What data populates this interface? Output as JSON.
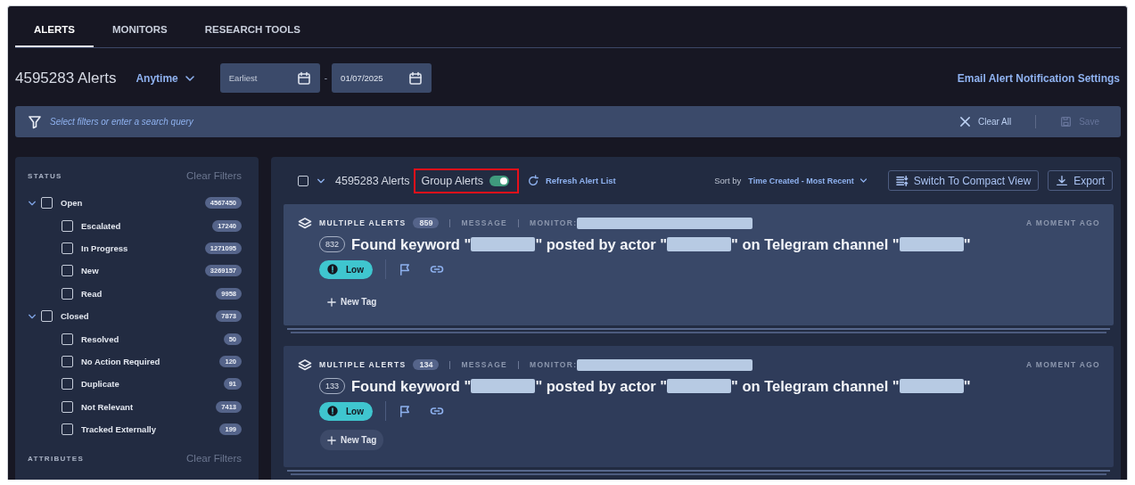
{
  "tabs": [
    {
      "label": "ALERTS",
      "selected": true
    },
    {
      "label": "MONITORS",
      "selected": false
    },
    {
      "label": "RESEARCH TOOLS",
      "selected": false
    }
  ],
  "header": {
    "count": "4595283 Alerts",
    "range": "Anytime",
    "date_from": {
      "placeholder": "Earliest"
    },
    "date_to": {
      "value": "01/07/2025"
    },
    "date_separator": "-",
    "settings_link": "Email Alert Notification Settings"
  },
  "filter_bar": {
    "placeholder": "Select filters or enter a search query",
    "clear": "Clear All",
    "save": {
      "label": "Save",
      "disabled": true
    }
  },
  "sidebar": {
    "sections": [
      {
        "title": "STATUS",
        "clear": "Clear Filters",
        "items": [
          {
            "label": "Open",
            "count": "4567450",
            "checked": false,
            "expanded": true,
            "children": [
              {
                "label": "Escalated",
                "count": "17240",
                "checked": false
              },
              {
                "label": "In Progress",
                "count": "1271095",
                "checked": false
              },
              {
                "label": "New",
                "count": "3269157",
                "checked": false
              },
              {
                "label": "Read",
                "count": "9958",
                "checked": false
              }
            ]
          },
          {
            "label": "Closed",
            "count": "7873",
            "checked": false,
            "expanded": true,
            "children": [
              {
                "label": "Resolved",
                "count": "50",
                "checked": false
              },
              {
                "label": "No Action Required",
                "count": "120",
                "checked": false
              },
              {
                "label": "Duplicate",
                "count": "91",
                "checked": false
              },
              {
                "label": "Not Relevant",
                "count": "7413",
                "checked": false
              },
              {
                "label": "Tracked Externally",
                "count": "199",
                "checked": false
              }
            ]
          }
        ]
      },
      {
        "title": "ATTRIBUTES",
        "clear": "Clear Filters"
      }
    ]
  },
  "list_header": {
    "select_all": false,
    "count": "4595283 Alerts",
    "group": {
      "label": "Group Alerts",
      "on": true,
      "highlighted": true
    },
    "refresh": "Refresh Alert List",
    "sort_label": "Sort by",
    "sort_value": "Time Created - Most Recent",
    "compact": "Switch To Compact View",
    "export": "Export"
  },
  "alerts": [
    {
      "type": "MULTIPLE ALERTS",
      "group_count": "859",
      "category": "MESSAGE",
      "monitor": "MONITOR:",
      "monitor_redacted": true,
      "time": "A MOMENT AGO",
      "count": "832",
      "title": [
        {
          "kind": "text",
          "text": "Found keyword \""
        },
        {
          "kind": "redacted"
        },
        {
          "kind": "text",
          "text": "\" posted by actor \""
        },
        {
          "kind": "redacted"
        },
        {
          "kind": "text",
          "text": "\" on Telegram channel \""
        },
        {
          "kind": "redacted"
        },
        {
          "kind": "text",
          "text": "\""
        }
      ],
      "severity": "Low",
      "new_tag": "New Tag"
    },
    {
      "type": "MULTIPLE ALERTS",
      "group_count": "134",
      "category": "MESSAGE",
      "monitor": "MONITOR:",
      "monitor_redacted": true,
      "time": "A MOMENT AGO",
      "count": "133",
      "title": [
        {
          "kind": "text",
          "text": "Found keyword \""
        },
        {
          "kind": "redacted"
        },
        {
          "kind": "text",
          "text": "\" posted by actor \""
        },
        {
          "kind": "redacted"
        },
        {
          "kind": "text",
          "text": "\" on Telegram channel \""
        },
        {
          "kind": "redacted"
        },
        {
          "kind": "text",
          "text": "\""
        }
      ],
      "severity": "Low",
      "new_tag": "New Tag"
    }
  ]
}
